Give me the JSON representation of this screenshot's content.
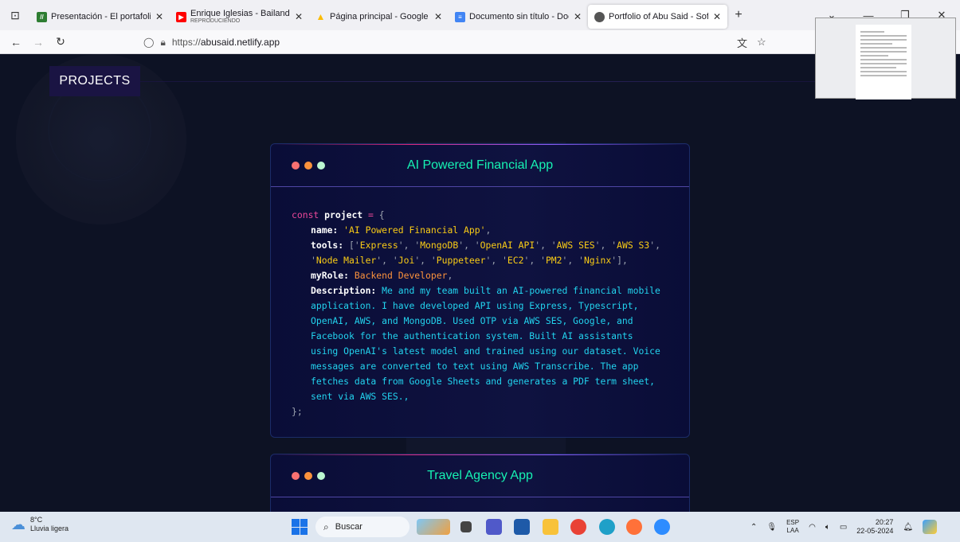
{
  "browser": {
    "tabs": [
      {
        "title": "Presentación - El portafolio de ",
        "favicon_color": "#2e7d32",
        "favicon_glyph": "//",
        "active": false
      },
      {
        "title": "Enrique Iglesias - Bailando ft. S",
        "subtitle": "REPRODUCIENDO",
        "favicon_color": "#ff0000",
        "favicon_glyph": "▶",
        "active": false
      },
      {
        "title": "Página principal - Google Drive",
        "favicon_color": "#fbbc04",
        "favicon_glyph": "▲",
        "active": false
      },
      {
        "title": "Documento sin título - Docume",
        "favicon_color": "#4285f4",
        "favicon_glyph": "≡",
        "active": false
      },
      {
        "title": "Portfolio of Abu Said - Softwar",
        "favicon_color": "#555555",
        "favicon_glyph": "●",
        "active": true
      }
    ],
    "new_tab": "+",
    "url_scheme": "https://",
    "url_host": "abusaid.netlify.app"
  },
  "page": {
    "section_label": "PROJECTS",
    "projects": [
      {
        "title": "AI Powered Financial App",
        "code": {
          "decl": "const",
          "var": "project",
          "name_key": "name:",
          "name_val": "'AI Powered Financial App'",
          "tools_key": "tools:",
          "tools": [
            "Express",
            "MongoDB",
            "OpenAI API",
            "AWS SES",
            "AWS S3",
            "Node Mailer",
            "Joi",
            "Puppeteer",
            "EC2",
            "PM2",
            "Nginx"
          ],
          "role_key": "myRole:",
          "role_val": "Backend Developer",
          "desc_key": "Description:",
          "desc_lines": [
            "Me and my team built an AI-powered financial mobile",
            "application. I have developed API using Express, Typescript,",
            "OpenAI, AWS, and MongoDB. Used OTP via AWS SES, Google, and",
            "Facebook for the authentication system. Built AI assistants",
            "using OpenAI's latest model and trained using our dataset. Voice",
            "messages are converted to text using AWS Transcribe. The app",
            "fetches data from Google Sheets and generates a PDF term sheet,",
            "sent via AWS SES.,"
          ],
          "close": "};"
        }
      },
      {
        "title": "Travel Agency App"
      }
    ],
    "colors": {
      "accent": "#16f2b3",
      "background": "#0d1224",
      "label_bg": "#1a1443"
    }
  },
  "taskbar": {
    "weather_temp": "8°C",
    "weather_desc": "Lluvia ligera",
    "search_placeholder": "Buscar",
    "lang_top": "ESP",
    "lang_bottom": "LAA",
    "time": "20:27",
    "date": "22-05-2024"
  }
}
